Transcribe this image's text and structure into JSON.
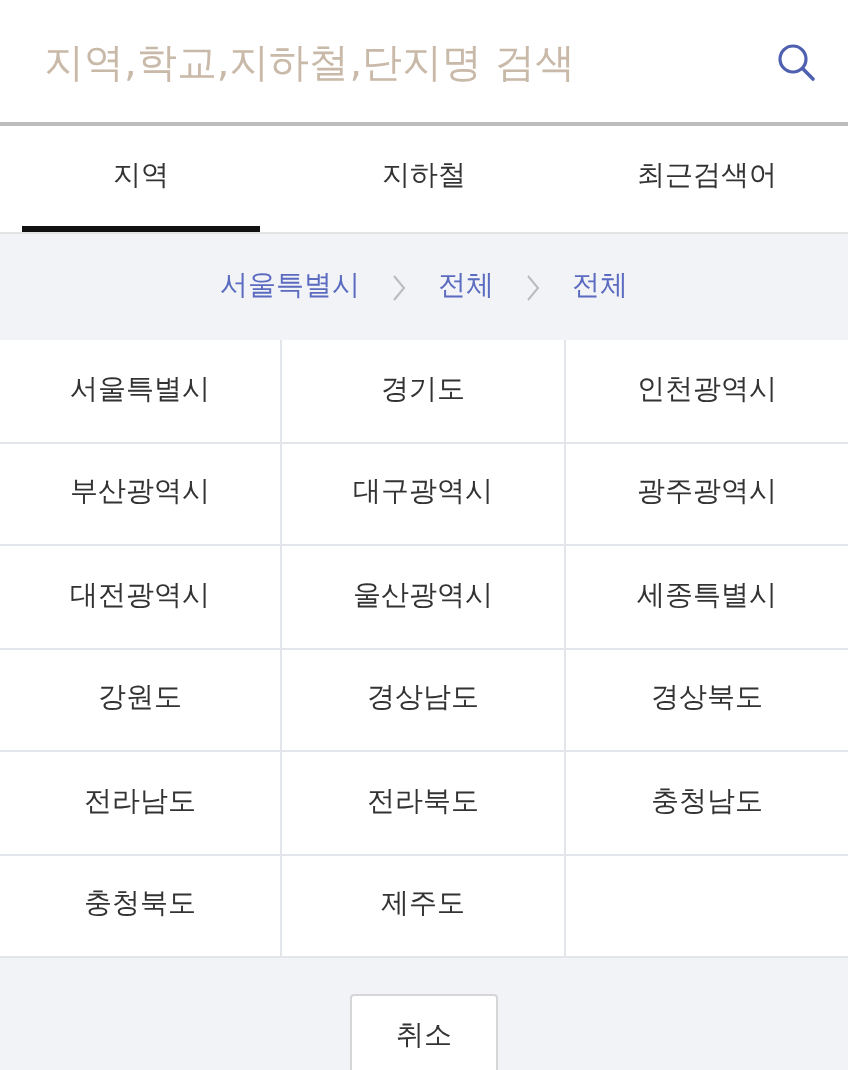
{
  "search": {
    "placeholder": "지역,학교,지하철,단지명 검색"
  },
  "tabs": [
    {
      "label": "지역",
      "selected": true
    },
    {
      "label": "지하철",
      "selected": false
    },
    {
      "label": "최근검색어",
      "selected": false
    }
  ],
  "breadcrumb": [
    "서울특별시",
    "전체",
    "전체"
  ],
  "regions": [
    "서울특별시",
    "경기도",
    "인천광역시",
    "부산광역시",
    "대구광역시",
    "광주광역시",
    "대전광역시",
    "울산광역시",
    "세종특별시",
    "강원도",
    "경상남도",
    "경상북도",
    "전라남도",
    "전라북도",
    "충청남도",
    "충청북도",
    "제주도"
  ],
  "buttons": [
    "취소"
  ]
}
